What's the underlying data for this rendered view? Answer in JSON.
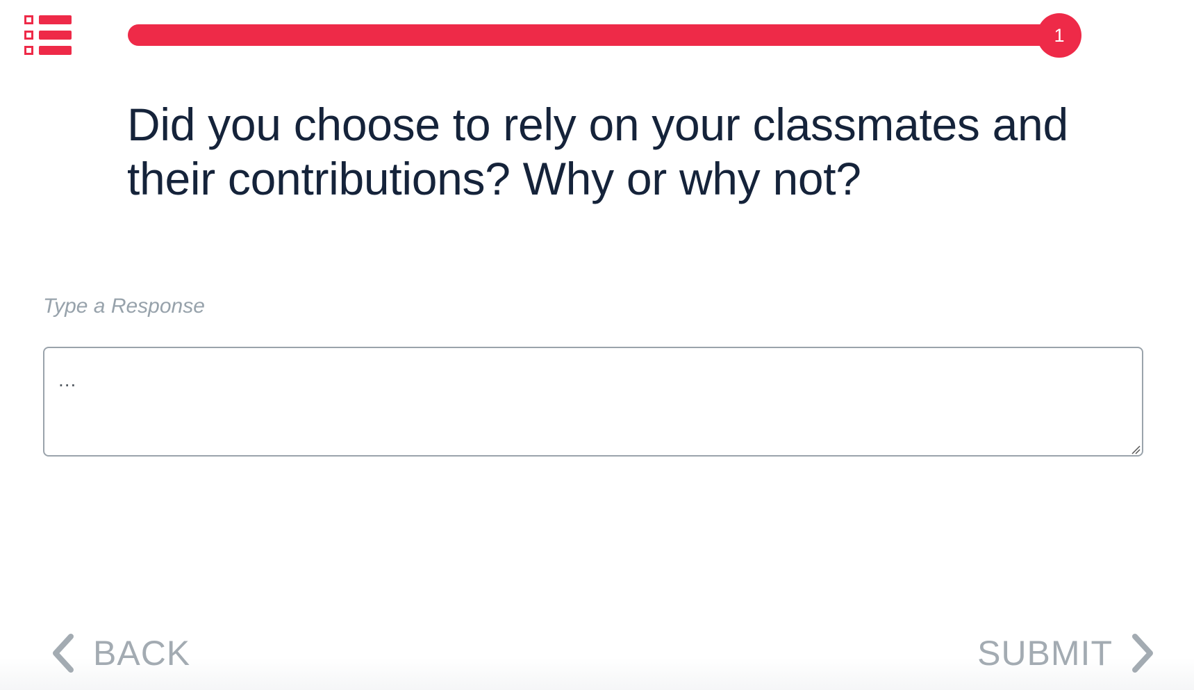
{
  "menu": {
    "icon": "list-menu-icon"
  },
  "progress": {
    "fraction": 1.0,
    "current_label": "1"
  },
  "question": {
    "text": "Did you choose to rely on your classmates and their contributions? Why or why not?"
  },
  "response": {
    "label": "Type a Response",
    "placeholder": "...",
    "value": ""
  },
  "navigation": {
    "back_label": "BACK",
    "submit_label": "SUBMIT"
  },
  "colors": {
    "accent": "#ee2a48",
    "text": "#15233a",
    "muted": "#a3abb2"
  }
}
